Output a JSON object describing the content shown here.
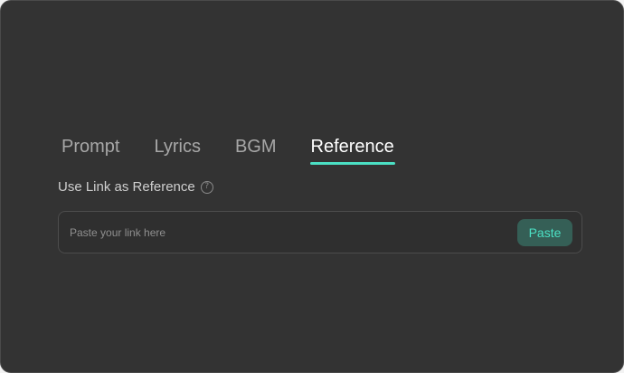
{
  "tabs": [
    {
      "label": "Prompt",
      "active": false
    },
    {
      "label": "Lyrics",
      "active": false
    },
    {
      "label": "BGM",
      "active": false
    },
    {
      "label": "Reference",
      "active": true
    }
  ],
  "reference": {
    "label": "Use Link as Reference",
    "help_icon": "question-mark-circle",
    "input": {
      "value": "",
      "placeholder": "Paste your link here"
    },
    "paste_label": "Paste"
  },
  "colors": {
    "panel_background": "#333333",
    "accent": "#4be0c4",
    "button_background": "#355f56"
  }
}
